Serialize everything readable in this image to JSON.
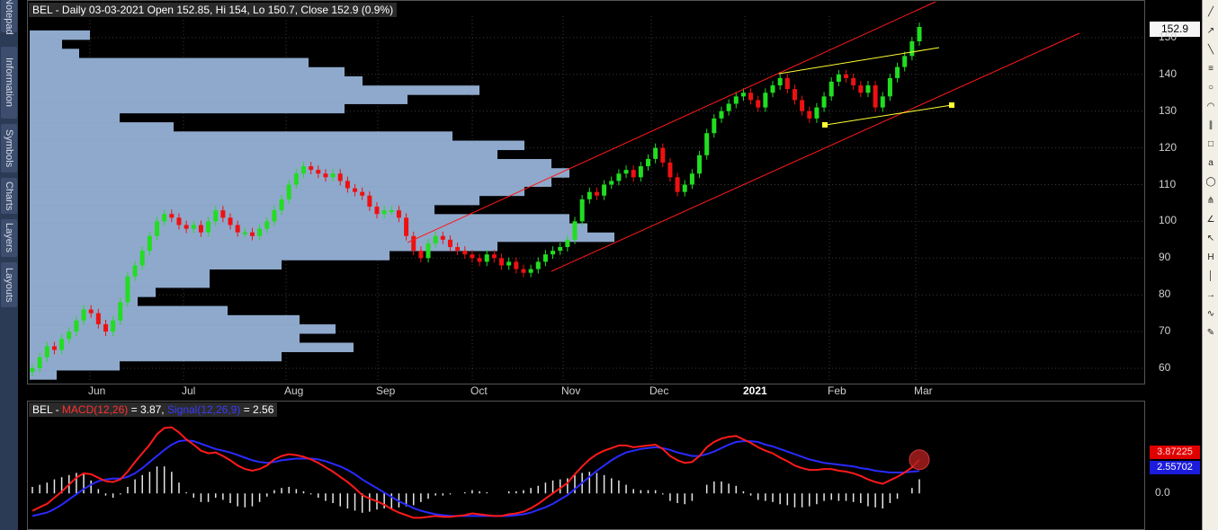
{
  "left_tabs": [
    "Notepad",
    "Information",
    "Symbols",
    "Charts",
    "Layers",
    "Layouts"
  ],
  "main_title": "BEL - Daily 03-03-2021 Open 152.85, Hi 154, Lo 150.7, Close 152.9 (0.9%)",
  "last_price": "152.9",
  "macd_title": {
    "prefix": "BEL - ",
    "macd_label": "MACD(12,26)",
    "macd_value": " = 3.87, ",
    "signal_label": "Signal(12,26,9)",
    "signal_value": " = 2.56"
  },
  "macd_readout": "3.87225",
  "signal_readout": "2.55702",
  "macd_zero": "0.0",
  "colors": {
    "up": "#22dd22",
    "down": "#ee1111",
    "profile": "#8fa9cc",
    "channel": "#ff1a1a",
    "wedge": "#ffff33",
    "macd": "#ff1a1a",
    "signal": "#2a2aff",
    "hist": "#e6e6e6",
    "grid": "#333333"
  },
  "right_toolbar": [
    "line-tool-icon",
    "ray-tool-icon",
    "trend-tool-icon",
    "fib-tool-icon",
    "cycle-tool-icon",
    "arc-tool-icon",
    "channel-tool-icon",
    "rectangle-tool-icon",
    "text-tool-icon",
    "ellipse-tool-icon",
    "pitchfork-tool-icon",
    "gann-tool-icon",
    "cursor-tool-icon",
    "hline-tool-icon",
    "vline-tool-icon",
    "arrow-tool-icon",
    "wave-tool-icon",
    "note-tool-icon"
  ],
  "chart_data": {
    "type": "candlestick",
    "title": "BEL - Daily 03-03-2021 Open 152.85, Hi 154, Lo 150.7, Close 152.9 (0.9%)",
    "y_ticks": [
      60,
      70,
      80,
      90,
      100,
      110,
      120,
      130,
      140,
      150
    ],
    "ylim": [
      55,
      157
    ],
    "x_labels": [
      "Jun",
      "Jul",
      "Aug",
      "Sep",
      "Oct",
      "Nov",
      "Dec",
      "2021",
      "Feb",
      "Mar"
    ],
    "close_series": [
      60,
      63,
      66,
      65,
      68,
      70,
      73,
      76,
      75,
      72,
      70,
      73,
      78,
      85,
      88,
      92,
      96,
      100,
      102,
      101,
      99,
      98,
      99,
      97,
      100,
      103,
      101,
      99,
      97,
      97,
      96,
      98,
      100,
      103,
      106,
      110,
      113,
      115,
      114,
      113,
      112,
      113,
      111,
      109,
      108,
      107,
      104,
      102,
      103,
      103,
      101,
      96,
      92,
      90,
      94,
      96,
      95,
      93,
      92,
      91,
      90,
      89,
      91,
      90,
      88,
      89,
      87,
      86,
      87,
      89,
      91,
      92,
      93,
      95,
      100,
      106,
      108,
      107,
      110,
      111,
      113,
      114,
      112,
      115,
      117,
      120,
      116,
      112,
      108,
      110,
      113,
      118,
      124,
      128,
      130,
      132,
      134,
      135,
      133,
      131,
      135,
      137,
      139,
      136,
      133,
      130,
      128,
      131,
      134,
      138,
      140,
      139,
      137,
      135,
      137,
      131,
      134,
      139,
      142,
      145,
      149,
      152.9
    ],
    "volume_profile": [
      {
        "price": 150.5,
        "len": 0.067
      },
      {
        "price": 148,
        "len": 0.036
      },
      {
        "price": 145.5,
        "len": 0.055
      },
      {
        "price": 143,
        "len": 0.31
      },
      {
        "price": 140.5,
        "len": 0.35
      },
      {
        "price": 138,
        "len": 0.37
      },
      {
        "price": 135.5,
        "len": 0.5
      },
      {
        "price": 133,
        "len": 0.42
      },
      {
        "price": 130.5,
        "len": 0.35
      },
      {
        "price": 128,
        "len": 0.1
      },
      {
        "price": 125.5,
        "len": 0.16
      },
      {
        "price": 123,
        "len": 0.47
      },
      {
        "price": 120.5,
        "len": 0.55
      },
      {
        "price": 118,
        "len": 0.52
      },
      {
        "price": 115.5,
        "len": 0.58
      },
      {
        "price": 113,
        "len": 0.6
      },
      {
        "price": 110.5,
        "len": 0.58
      },
      {
        "price": 108,
        "len": 0.55
      },
      {
        "price": 105.5,
        "len": 0.5
      },
      {
        "price": 103,
        "len": 0.45
      },
      {
        "price": 100.5,
        "len": 0.6
      },
      {
        "price": 98,
        "len": 0.62
      },
      {
        "price": 95.5,
        "len": 0.65
      },
      {
        "price": 93,
        "len": 0.52
      },
      {
        "price": 90.5,
        "len": 0.4
      },
      {
        "price": 88,
        "len": 0.28
      },
      {
        "price": 85.5,
        "len": 0.2
      },
      {
        "price": 83,
        "len": 0.2
      },
      {
        "price": 80.5,
        "len": 0.14
      },
      {
        "price": 78,
        "len": 0.12
      },
      {
        "price": 75.5,
        "len": 0.22
      },
      {
        "price": 73,
        "len": 0.3
      },
      {
        "price": 70.5,
        "len": 0.34
      },
      {
        "price": 68,
        "len": 0.3
      },
      {
        "price": 65.5,
        "len": 0.36
      },
      {
        "price": 63,
        "len": 0.28
      },
      {
        "price": 60.5,
        "len": 0.1
      },
      {
        "price": 58,
        "len": 0.03
      }
    ],
    "macd": [
      -2,
      -1.6,
      -1.2,
      -0.5,
      0.2,
      1,
      1.8,
      2.3,
      2.2,
      1.8,
      1.4,
      1.3,
      1.6,
      2.5,
      3.6,
      4.6,
      5.6,
      6.8,
      7.5,
      7.6,
      7,
      6.2,
      5.6,
      4.9,
      4.6,
      4.7,
      4.3,
      3.8,
      3.2,
      2.8,
      2.6,
      2.8,
      3.2,
      3.9,
      4.3,
      4.5,
      4.4,
      4.2,
      3.9,
      3.5,
      3,
      2.5,
      1.9,
      1.3,
      0.6,
      -0.2,
      -0.6,
      -0.9,
      -1.3,
      -1.8,
      -2.2,
      -2.5,
      -2.8,
      -2.8,
      -2.7,
      -2.6,
      -2.7,
      -2.7,
      -2.6,
      -2.5,
      -2.3,
      -2.4,
      -2.5,
      -2.6,
      -2.6,
      -2.4,
      -2.3,
      -2.1,
      -1.7,
      -1.2,
      -0.6,
      0,
      0.6,
      1.2,
      2.2,
      3.1,
      3.9,
      4.5,
      4.9,
      5.2,
      5.5,
      5.5,
      5.3,
      5.4,
      5.5,
      5.6,
      5.1,
      4.3,
      3.8,
      3.5,
      3.6,
      4.3,
      5.3,
      5.9,
      6.3,
      6.5,
      6.6,
      6.2,
      5.8,
      5.3,
      4.9,
      4.6,
      4.1,
      3.7,
      3.2,
      2.9,
      2.7,
      2.7,
      2.8,
      2.8,
      2.6,
      2.5,
      2.3,
      2.0,
      1.6,
      1.3,
      1.1,
      1.5,
      1.9,
      2.4,
      3.0,
      3.87
    ],
    "signal": [
      -2.6,
      -2.4,
      -2.2,
      -1.8,
      -1.3,
      -0.7,
      -0.1,
      0.5,
      1,
      1.4,
      1.6,
      1.7,
      1.7,
      1.9,
      2.3,
      2.9,
      3.6,
      4.3,
      5,
      5.6,
      6,
      6.1,
      6,
      5.7,
      5.4,
      5.1,
      4.9,
      4.7,
      4.4,
      4.1,
      3.8,
      3.6,
      3.5,
      3.6,
      3.8,
      3.9,
      4,
      4,
      4,
      3.9,
      3.7,
      3.4,
      3.1,
      2.7,
      2.2,
      1.6,
      1.1,
      0.6,
      0.1,
      -0.4,
      -0.9,
      -1.3,
      -1.7,
      -2,
      -2.2,
      -2.4,
      -2.5,
      -2.6,
      -2.6,
      -2.6,
      -2.6,
      -2.6,
      -2.6,
      -2.6,
      -2.6,
      -2.6,
      -2.5,
      -2.4,
      -2.2,
      -1.9,
      -1.6,
      -1.2,
      -0.7,
      -0.2,
      0.5,
      1.2,
      1.9,
      2.6,
      3.2,
      3.8,
      4.3,
      4.7,
      4.9,
      5.1,
      5.2,
      5.3,
      5.2,
      5,
      4.7,
      4.5,
      4.3,
      4.3,
      4.5,
      4.8,
      5.2,
      5.6,
      5.9,
      6,
      6,
      5.9,
      5.6,
      5.4,
      5.1,
      4.8,
      4.5,
      4.2,
      3.9,
      3.7,
      3.5,
      3.4,
      3.3,
      3.2,
      3.1,
      2.9,
      2.8,
      2.6,
      2.5,
      2.4,
      2.4,
      2.4,
      2.5,
      2.56
    ],
    "macd_ylim": [
      -4,
      9
    ]
  }
}
